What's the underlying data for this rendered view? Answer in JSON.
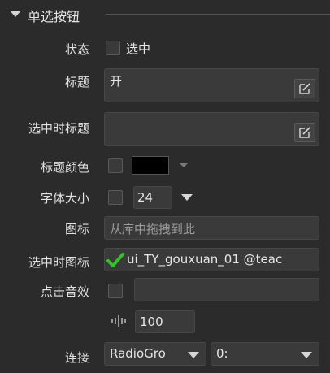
{
  "section": {
    "title": "单选按钮"
  },
  "fields": {
    "state": {
      "label": "状态",
      "checkbox_label": "选中"
    },
    "title": {
      "label": "标题",
      "value": "开"
    },
    "checked_title": {
      "label": "选中时标题",
      "value": ""
    },
    "title_color": {
      "label": "标题颜色",
      "swatch_color": "#000000"
    },
    "font_size": {
      "label": "字体大小",
      "value": "24"
    },
    "icon": {
      "label": "图标",
      "placeholder": "从库中拖拽到此"
    },
    "checked_icon": {
      "label": "选中时图标",
      "value": "ui_TY_gouxuan_01 @teac"
    },
    "click_sound": {
      "label": "点击音效",
      "value": "",
      "volume": "100"
    },
    "link": {
      "label": "连接",
      "group_value": "RadioGro",
      "index_value": "0:"
    }
  },
  "colors": {
    "background": "#2b2b2b",
    "field": "#3a3a3a",
    "check_green": "#35c12a"
  }
}
